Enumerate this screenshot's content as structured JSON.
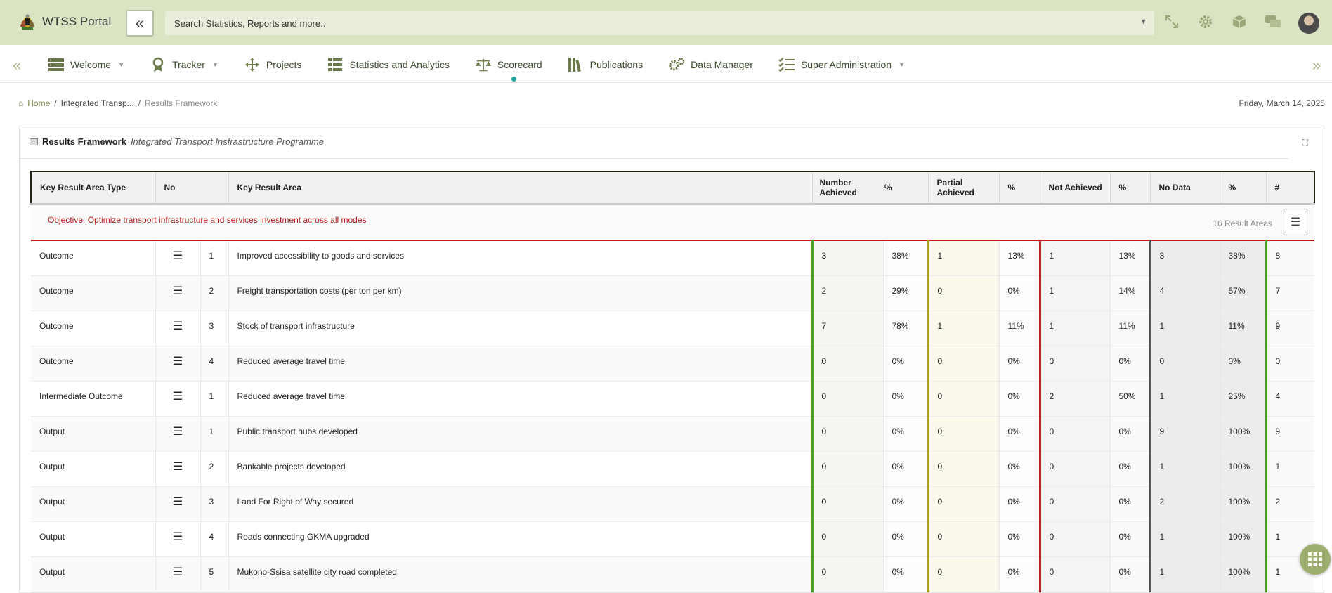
{
  "app": {
    "title": "WTSS Portal"
  },
  "search": {
    "placeholder": "Search Statistics, Reports and more.."
  },
  "menu": [
    {
      "label": "Welcome",
      "icon": "server-icon",
      "has_dropdown": true
    },
    {
      "label": "Tracker",
      "icon": "award-icon",
      "has_dropdown": true
    },
    {
      "label": "Projects",
      "icon": "move-arrows-icon",
      "has_dropdown": false
    },
    {
      "label": "Statistics and Analytics",
      "icon": "list-icon",
      "has_dropdown": false
    },
    {
      "label": "Scorecard",
      "icon": "balance-scale-icon",
      "has_dropdown": false,
      "active": true
    },
    {
      "label": "Publications",
      "icon": "books-icon",
      "has_dropdown": false
    },
    {
      "label": "Data Manager",
      "icon": "gears-icon",
      "has_dropdown": false
    },
    {
      "label": "Super Administration",
      "icon": "checklist-icon",
      "has_dropdown": true
    }
  ],
  "breadcrumb": {
    "home": "Home",
    "sep": "/",
    "middle": "Integrated Transp...",
    "current": "Results Framework"
  },
  "date": "Friday, March 14, 2025",
  "card": {
    "title": "Results Framework",
    "subtitle": "Integrated Transport Insfrastructure Programme"
  },
  "table": {
    "headers": [
      "Key Result Area Type",
      "No",
      "Key Result Area",
      "Number Achieved",
      "%",
      "Partial Achieved",
      "%",
      "Not Achieved",
      "%",
      "No Data",
      "%",
      "#"
    ],
    "objective": "Objective: Optimize transport infrastructure and services investment across all modes",
    "result_count": "16 Result Areas",
    "rows": [
      {
        "type": "Outcome",
        "no": "1",
        "area": "Improved accessibility to goods and services",
        "ach": "3",
        "ach_pct": "38%",
        "par": "1",
        "par_pct": "13%",
        "not": "1",
        "not_pct": "13%",
        "nod": "3",
        "nod_pct": "38%",
        "total": "8"
      },
      {
        "type": "Outcome",
        "no": "2",
        "area": "Freight transportation costs (per ton per km)",
        "ach": "2",
        "ach_pct": "29%",
        "par": "0",
        "par_pct": "0%",
        "not": "1",
        "not_pct": "14%",
        "nod": "4",
        "nod_pct": "57%",
        "total": "7"
      },
      {
        "type": "Outcome",
        "no": "3",
        "area": "Stock of transport infrastructure",
        "ach": "7",
        "ach_pct": "78%",
        "par": "1",
        "par_pct": "11%",
        "not": "1",
        "not_pct": "11%",
        "nod": "1",
        "nod_pct": "11%",
        "total": "9"
      },
      {
        "type": "Outcome",
        "no": "4",
        "area": "Reduced average travel time",
        "ach": "0",
        "ach_pct": "0%",
        "par": "0",
        "par_pct": "0%",
        "not": "0",
        "not_pct": "0%",
        "nod": "0",
        "nod_pct": "0%",
        "total": "0"
      },
      {
        "type": "Intermediate Outcome",
        "no": "1",
        "area": "Reduced average travel time",
        "ach": "0",
        "ach_pct": "0%",
        "par": "0",
        "par_pct": "0%",
        "not": "2",
        "not_pct": "50%",
        "nod": "1",
        "nod_pct": "25%",
        "total": "4"
      },
      {
        "type": "Output",
        "no": "1",
        "area": "Public transport hubs developed",
        "ach": "0",
        "ach_pct": "0%",
        "par": "0",
        "par_pct": "0%",
        "not": "0",
        "not_pct": "0%",
        "nod": "9",
        "nod_pct": "100%",
        "total": "9"
      },
      {
        "type": "Output",
        "no": "2",
        "area": "Bankable projects developed",
        "ach": "0",
        "ach_pct": "0%",
        "par": "0",
        "par_pct": "0%",
        "not": "0",
        "not_pct": "0%",
        "nod": "1",
        "nod_pct": "100%",
        "total": "1"
      },
      {
        "type": "Output",
        "no": "3",
        "area": "Land For Right of Way secured",
        "ach": "0",
        "ach_pct": "0%",
        "par": "0",
        "par_pct": "0%",
        "not": "0",
        "not_pct": "0%",
        "nod": "2",
        "nod_pct": "100%",
        "total": "2"
      },
      {
        "type": "Output",
        "no": "4",
        "area": "Roads connecting GKMA upgraded",
        "ach": "0",
        "ach_pct": "0%",
        "par": "0",
        "par_pct": "0%",
        "not": "0",
        "not_pct": "0%",
        "nod": "1",
        "nod_pct": "100%",
        "total": "1"
      },
      {
        "type": "Output",
        "no": "5",
        "area": "Mukono-Ssisa satellite city road completed",
        "ach": "0",
        "ach_pct": "0%",
        "par": "0",
        "par_pct": "0%",
        "not": "0",
        "not_pct": "0%",
        "nod": "1",
        "nod_pct": "100%",
        "total": "1"
      }
    ]
  }
}
